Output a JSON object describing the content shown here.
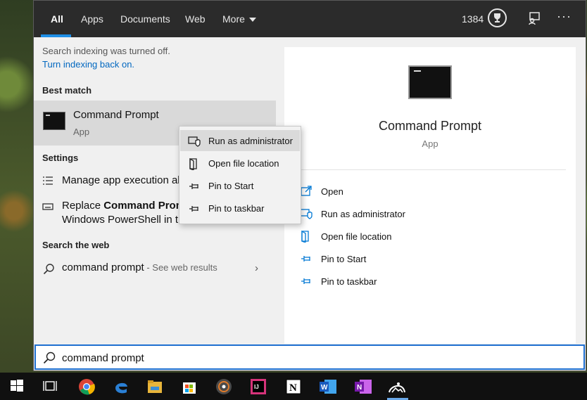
{
  "tabs": [
    {
      "label": "All"
    },
    {
      "label": "Apps"
    },
    {
      "label": "Documents"
    },
    {
      "label": "Web"
    },
    {
      "label": "More"
    }
  ],
  "header": {
    "points": "1384",
    "more_icon": "ellipsis-icon"
  },
  "notice": {
    "text": "Search indexing was turned off.",
    "link": "Turn indexing back on."
  },
  "sections": {
    "best_match": "Best match",
    "settings": "Settings",
    "search_web": "Search the web"
  },
  "best_match": {
    "title": "Command Prompt",
    "subtitle": "App"
  },
  "settings": {
    "item1": "Manage app execution al",
    "item2_prefix": "Replace ",
    "item2_bold": "Command Prom",
    "item2_line2": "Windows PowerShell in the Win + X"
  },
  "web": {
    "query": "command prompt",
    "suffix": " - See web results"
  },
  "preview": {
    "title": "Command Prompt",
    "subtitle": "App",
    "actions": [
      {
        "label": "Open",
        "icon": "open-icon"
      },
      {
        "label": "Run as administrator",
        "icon": "shield-icon"
      },
      {
        "label": "Open file location",
        "icon": "file-location-icon"
      },
      {
        "label": "Pin to Start",
        "icon": "pin-icon"
      },
      {
        "label": "Pin to taskbar",
        "icon": "pin-icon"
      }
    ]
  },
  "context_menu": [
    {
      "label": "Run as administrator",
      "icon": "shield-icon"
    },
    {
      "label": "Open file location",
      "icon": "file-location-icon"
    },
    {
      "label": "Pin to Start",
      "icon": "pin-icon"
    },
    {
      "label": "Pin to taskbar",
      "icon": "pin-icon"
    }
  ],
  "search": {
    "value": "command prompt"
  },
  "taskbar": [
    "windows-start-icon",
    "task-view-icon",
    "chrome-icon",
    "edge-icon",
    "file-explorer-icon",
    "store-icon",
    "media-player-icon",
    "intellij-icon",
    "notion-icon",
    "word-icon",
    "onenote-icon",
    "photos-icon"
  ],
  "colors": {
    "accent": "#1f8fe6",
    "topbar": "#2b2b2b",
    "link": "#0067c0"
  }
}
